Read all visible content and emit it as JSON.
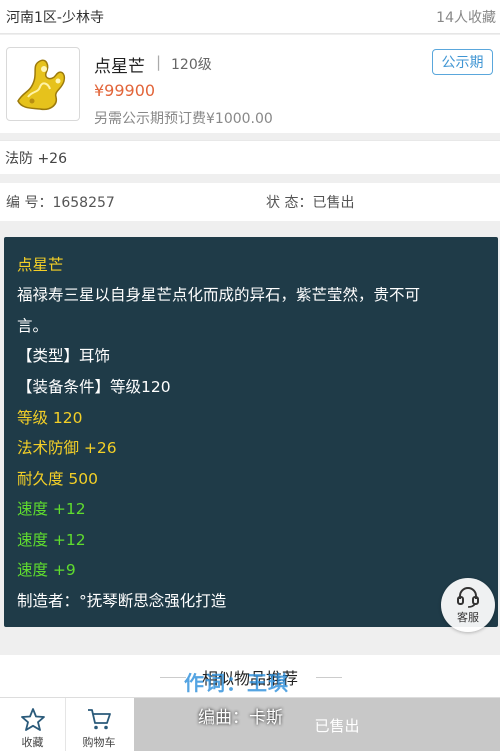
{
  "header": {
    "server": "河南1区-少林寺",
    "watchers": "14人收藏"
  },
  "item": {
    "name": "点星芒",
    "separator": "|",
    "level": "120级",
    "price": "¥99900",
    "deposit": "另需公示期预订费¥1000.00",
    "badge": "公示期",
    "icon": "golden-ornament-icon"
  },
  "attribute": "法防 +26",
  "info": {
    "serial": "编  号：1658257",
    "status": "状  态：已售出"
  },
  "detail": {
    "lines": [
      {
        "text": "点星芒",
        "color": "#f3cf27"
      },
      {
        "text": "福禄寿三星以自身星芒点化而成的异石，紫芒莹然，贵不可",
        "color": "#ffffff"
      },
      {
        "text": "言。",
        "color": "#ffffff"
      },
      {
        "text": "【类型】耳饰",
        "color": "#ffffff"
      },
      {
        "text": "【装备条件】等级120",
        "color": "#ffffff"
      },
      {
        "text": "等级 120",
        "color": "#f3cf27"
      },
      {
        "text": "法术防御 +26",
        "color": "#f3cf27"
      },
      {
        "text": "耐久度 500",
        "color": "#f3cf27"
      },
      {
        "text": "速度 +12",
        "color": "#5fdc2e"
      },
      {
        "text": "速度 +12",
        "color": "#5fdc2e"
      },
      {
        "text": "速度 +9",
        "color": "#5fdc2e"
      },
      {
        "text": "制造者：°抚琴断思念强化打造",
        "color": "#ffffff"
      }
    ],
    "service_label": "客服"
  },
  "similar": {
    "title": "相似物品推荐"
  },
  "overlay": {
    "caption_1": "作词：王琪",
    "caption_2": "编曲：卡斯"
  },
  "bottom": {
    "favorite": "收藏",
    "cart": "购物车",
    "status_button": "已售出"
  }
}
